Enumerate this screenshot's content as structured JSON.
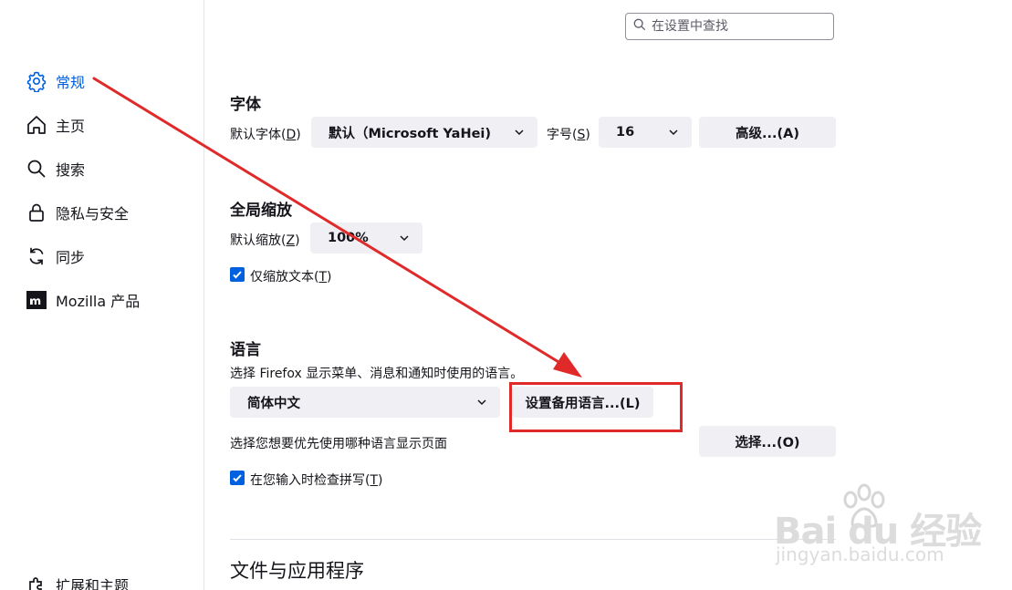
{
  "sidebar": {
    "items": [
      {
        "label": "常规",
        "icon": "gear-icon",
        "active": true
      },
      {
        "label": "主页",
        "icon": "home-icon"
      },
      {
        "label": "搜索",
        "icon": "search-icon"
      },
      {
        "label": "隐私与安全",
        "icon": "lock-icon"
      },
      {
        "label": "同步",
        "icon": "sync-icon"
      },
      {
        "label": "Mozilla 产品",
        "icon": "mozilla-icon"
      },
      {
        "label": "扩展和主题",
        "icon": "puzzle-icon"
      }
    ],
    "active_color": "#0061e0"
  },
  "search": {
    "placeholder": "在设置中查找"
  },
  "fonts": {
    "heading": "字体",
    "default_font_label": "默认字体(",
    "default_font_key": "D",
    "default_font_value": "默认（Microsoft YaHei)",
    "size_label": "字号(",
    "size_key": "S",
    "size_value": "16",
    "advanced_button": "高级...(A)"
  },
  "zoom": {
    "heading": "全局缩放",
    "default_zoom_label": "默认缩放(",
    "default_zoom_key": "Z",
    "default_zoom_value": "100%",
    "text_only_label": "仅缩放文本(",
    "text_only_key": "T",
    "text_only_checked": true
  },
  "language": {
    "heading": "语言",
    "description": "选择 Firefox 显示菜单、消息和通知时使用的语言。",
    "ui_language_value": "简体中文",
    "alternatives_button": "设置备用语言...(L)",
    "page_language_text": "选择您想要优先使用哪种语言显示页面",
    "choose_button": "选择...(O)",
    "spellcheck_label": "在您输入时检查拼写(",
    "spellcheck_key": "T",
    "spellcheck_checked": true
  },
  "files_apps": {
    "heading": "文件与应用程序"
  },
  "annotation": {
    "color": "#e02a2a"
  },
  "watermark": {
    "main": "Bai  du 经验",
    "sub": "jingyan.baidu.com"
  },
  "colors": {
    "accent": "#0061e0",
    "button_bg": "#f0f0f4",
    "annotation": "#e02a2a"
  }
}
